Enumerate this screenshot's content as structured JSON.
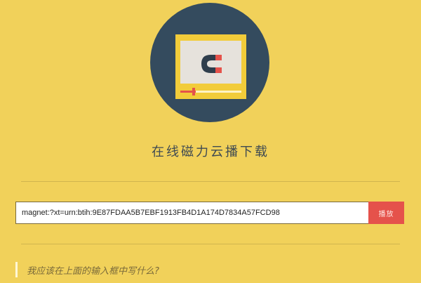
{
  "title": "在线磁力云播下载",
  "search": {
    "value": "magnet:?xt=urn:btih:9E87FDAA5B7EBF1913FB4D1A174D7834A57FCD98",
    "button_label": "播放"
  },
  "faq": {
    "question": "我应该在上面的输入框中写什么?"
  },
  "colors": {
    "background": "#F1D15A",
    "logo_circle": "#344B5E",
    "accent_red": "#E5524B",
    "accent_yellow": "#F2CC3A"
  },
  "icons": {
    "logo": "magnet-screen-icon"
  }
}
